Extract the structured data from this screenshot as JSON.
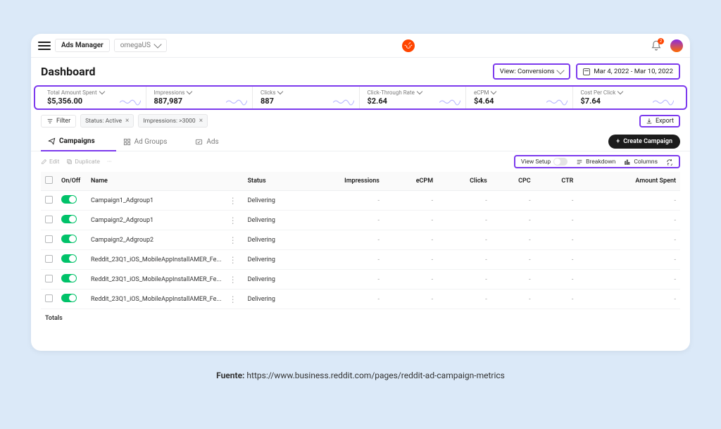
{
  "topbar": {
    "brand_label": "Ads Manager",
    "account": "omegaUS",
    "notification_count": "2"
  },
  "page": {
    "title": "Dashboard",
    "view_selector": "View: Conversions",
    "date_range": "Mar 4, 2022 - Mar 10, 2022"
  },
  "metrics": [
    {
      "label": "Total Amount Spent",
      "value": "$5,356.00"
    },
    {
      "label": "Impressions",
      "value": "887,987"
    },
    {
      "label": "Clicks",
      "value": "887"
    },
    {
      "label": "Click-Through Rate",
      "value": "$2.64"
    },
    {
      "label": "eCPM",
      "value": "$4.64"
    },
    {
      "label": "Cost Per Click",
      "value": "$7.64"
    }
  ],
  "filters": {
    "button": "Filter",
    "chips": [
      "Status: Active",
      "Impressions: >3000"
    ],
    "export": "Export"
  },
  "tabs": {
    "campaigns": "Campaigns",
    "adgroups": "Ad Groups",
    "ads": "Ads",
    "create": "Create Campaign"
  },
  "row_actions": {
    "edit": "Edit",
    "duplicate": "Duplicate",
    "view_setup": "View Setup",
    "breakdown": "Breakdown",
    "columns": "Columns"
  },
  "table": {
    "headers": {
      "onoff": "On/Off",
      "name": "Name",
      "status": "Status",
      "impressions": "Impressions",
      "ecpm": "eCPM",
      "clicks": "Clicks",
      "cpc": "CPC",
      "ctr": "CTR",
      "amount": "Amount Spent"
    },
    "rows": [
      {
        "name": "Campaign1_Adgroup1",
        "status": "Delivering"
      },
      {
        "name": "Campaign2_Adgroup1",
        "status": "Delivering"
      },
      {
        "name": "Campaign2_Adgroup2",
        "status": "Delivering"
      },
      {
        "name": "Reddit_23Q1_iOS_MobileAppInstallAMER_Fe...",
        "status": "Delivering"
      },
      {
        "name": "Reddit_23Q1_iOS_MobileAppInstallAMER_Fe...",
        "status": "Delivering"
      },
      {
        "name": "Reddit_23Q1_iOS_MobileAppInstallAMER_Fe...",
        "status": "Delivering"
      }
    ],
    "totals_label": "Totals"
  },
  "caption": {
    "prefix": "Fuente: ",
    "url": "https://www.business.reddit.com/pages/reddit-ad-campaign-metrics"
  }
}
